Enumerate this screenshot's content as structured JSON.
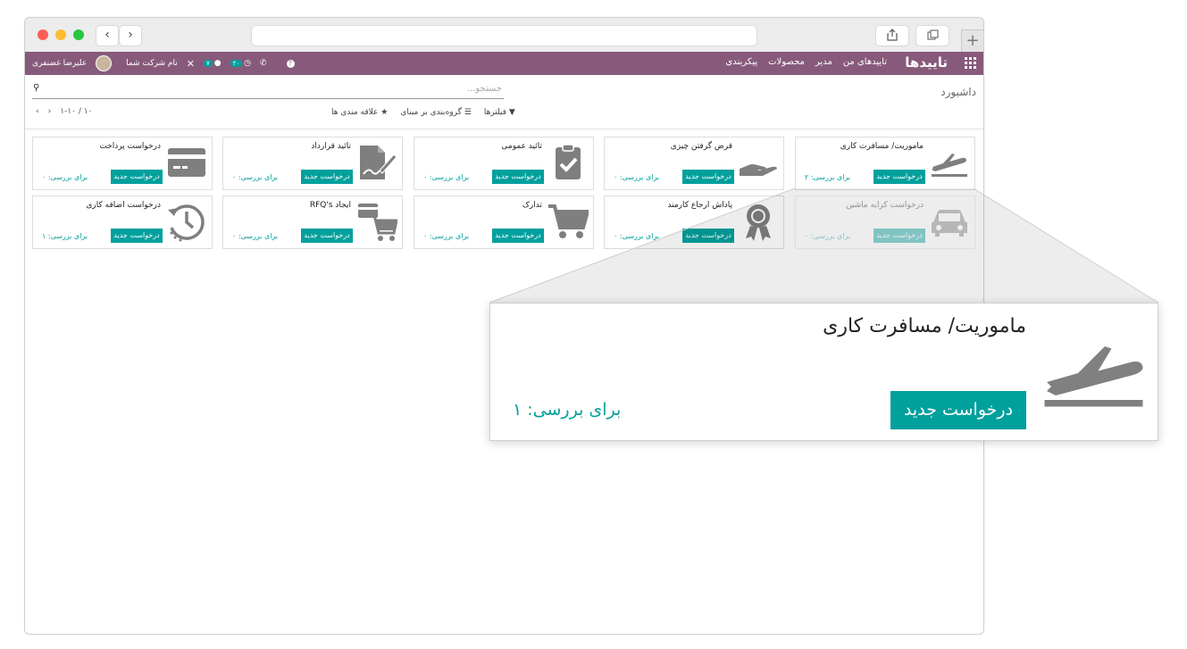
{
  "topbar": {
    "app_title": "تاییدها",
    "menu": [
      "تاییدهای من",
      "مدیر",
      "محصولات",
      "پیکربندی"
    ],
    "company": "نام شرکت شما",
    "user": "علیرضا غضنفری",
    "badge_messages": "۷",
    "badge_activities": "۲۰"
  },
  "subbar": {
    "breadcrumb": "داشبورد",
    "search_placeholder": "جستجو...",
    "filters": "فیلترها",
    "group_by": "گروه‌بندی بر مبنای",
    "favorites": "علاقه مندی ها",
    "pager": "۱-۱۰ / ۱۰"
  },
  "cards": [
    {
      "title": "ماموریت/ مسافرت کاری",
      "button": "درخواست جدید",
      "review": "برای بررسی: ۲",
      "icon": "plane-icon"
    },
    {
      "title": "قرض گرفتن چیزی",
      "button": "درخواست جدید",
      "review": "برای بررسی: ۰",
      "icon": "hand-icon"
    },
    {
      "title": "تائید عمومی",
      "button": "درخواست جدید",
      "review": "برای بررسی: ۰",
      "icon": "clipboard-check-icon"
    },
    {
      "title": "تائید قرارداد",
      "button": "درخواست جدید",
      "review": "برای بررسی: ۰",
      "icon": "contract-sign-icon"
    },
    {
      "title": "درخواست پرداخت",
      "button": "درخواست جدید",
      "review": "برای بررسی: ۰",
      "icon": "credit-card-icon"
    },
    {
      "title": "درخواست کرایه ماشین",
      "button": "درخواست جدید",
      "review": "برای بررسی: ۰",
      "icon": "car-icon"
    },
    {
      "title": "پاداش ارجاع کارمند",
      "button": "درخواست جدید",
      "review": "برای بررسی: ۰",
      "icon": "award-icon"
    },
    {
      "title": "تدارک",
      "button": "درخواست جدید",
      "review": "برای بررسی: ۰",
      "icon": "cart-icon"
    },
    {
      "title": "ایجاد RFQ's",
      "button": "درخواست جدید",
      "review": "برای بررسی: ۰",
      "icon": "rfq-cart-icon"
    },
    {
      "title": "درخواست اضافه کاری",
      "button": "درخواست جدید",
      "review": "برای بررسی: ۱",
      "icon": "history-clock-icon"
    }
  ],
  "zoom": {
    "title": "ماموریت/ مسافرت کاری",
    "button": "درخواست جدید",
    "review": "برای بررسی: ۱",
    "icon": "plane-icon"
  },
  "colors": {
    "topbar": "#875a7b",
    "accent": "#00a09d"
  }
}
